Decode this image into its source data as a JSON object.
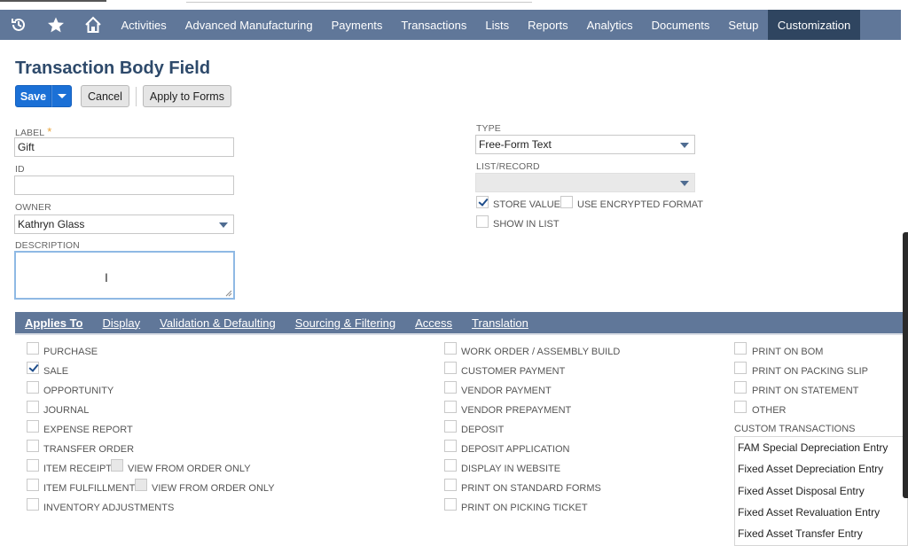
{
  "nav": {
    "icons": [
      "history-icon",
      "star-icon",
      "home-icon"
    ],
    "items": [
      "Activities",
      "Advanced Manufacturing",
      "Payments",
      "Transactions",
      "Lists",
      "Reports",
      "Analytics",
      "Documents",
      "Setup",
      "Customization"
    ],
    "active": "Customization"
  },
  "page": {
    "title": "Transaction Body Field"
  },
  "buttons": {
    "save": "Save",
    "cancel": "Cancel",
    "apply_to_forms": "Apply to Forms"
  },
  "form": {
    "label": {
      "label": "LABEL",
      "required_mark": "*",
      "value": "Gift"
    },
    "id": {
      "label": "ID",
      "value": ""
    },
    "owner": {
      "label": "OWNER",
      "value": "Kathryn Glass"
    },
    "description": {
      "label": "DESCRIPTION",
      "value": ""
    },
    "type": {
      "label": "TYPE",
      "value": "Free-Form Text"
    },
    "list_record": {
      "label": "LIST/RECORD",
      "value": ""
    },
    "store_value": {
      "label": "STORE VALUE",
      "checked": true
    },
    "use_encrypted": {
      "label": "USE ENCRYPTED FORMAT",
      "checked": false
    },
    "show_in_list": {
      "label": "SHOW IN LIST",
      "checked": false
    }
  },
  "subtabs": [
    "Applies To",
    "Display",
    "Validation & Defaulting",
    "Sourcing & Filtering",
    "Access",
    "Translation"
  ],
  "applies_to": {
    "col1": [
      {
        "label": "PURCHASE",
        "checked": false
      },
      {
        "label": "SALE",
        "checked": true
      },
      {
        "label": "OPPORTUNITY",
        "checked": false
      },
      {
        "label": "JOURNAL",
        "checked": false
      },
      {
        "label": "EXPENSE REPORT",
        "checked": false
      },
      {
        "label": "TRANSFER ORDER",
        "checked": false
      },
      {
        "label": "ITEM RECEIPT",
        "checked": false
      },
      {
        "label": "ITEM FULFILLMENT",
        "checked": false
      },
      {
        "label": "INVENTORY ADJUSTMENTS",
        "checked": false
      }
    ],
    "view_from_order_only": "VIEW FROM ORDER ONLY",
    "col2": [
      {
        "label": "WORK ORDER / ASSEMBLY BUILD",
        "checked": false
      },
      {
        "label": "CUSTOMER PAYMENT",
        "checked": false
      },
      {
        "label": "VENDOR PAYMENT",
        "checked": false
      },
      {
        "label": "VENDOR PREPAYMENT",
        "checked": false
      },
      {
        "label": "DEPOSIT",
        "checked": false
      },
      {
        "label": "DEPOSIT APPLICATION",
        "checked": false
      },
      {
        "label": "DISPLAY IN WEBSITE",
        "checked": false
      },
      {
        "label": "PRINT ON STANDARD FORMS",
        "checked": false
      },
      {
        "label": "PRINT ON PICKING TICKET",
        "checked": false
      }
    ],
    "col3": [
      {
        "label": "PRINT ON BOM",
        "checked": false
      },
      {
        "label": "PRINT ON PACKING SLIP",
        "checked": false
      },
      {
        "label": "PRINT ON STATEMENT",
        "checked": false
      },
      {
        "label": "OTHER",
        "checked": false
      }
    ],
    "custom_transactions_label": "CUSTOM TRANSACTIONS",
    "custom_transactions": [
      "FAM Special Depreciation Entry",
      "Fixed Asset Depreciation Entry",
      "Fixed Asset Disposal Entry",
      "Fixed Asset Revaluation Entry",
      "Fixed Asset Transfer Entry"
    ]
  },
  "colors": {
    "nav_bg": "#607799",
    "nav_active_bg": "#2f4560",
    "primary_button": "#1b70d6",
    "title": "#2e4a6b"
  }
}
